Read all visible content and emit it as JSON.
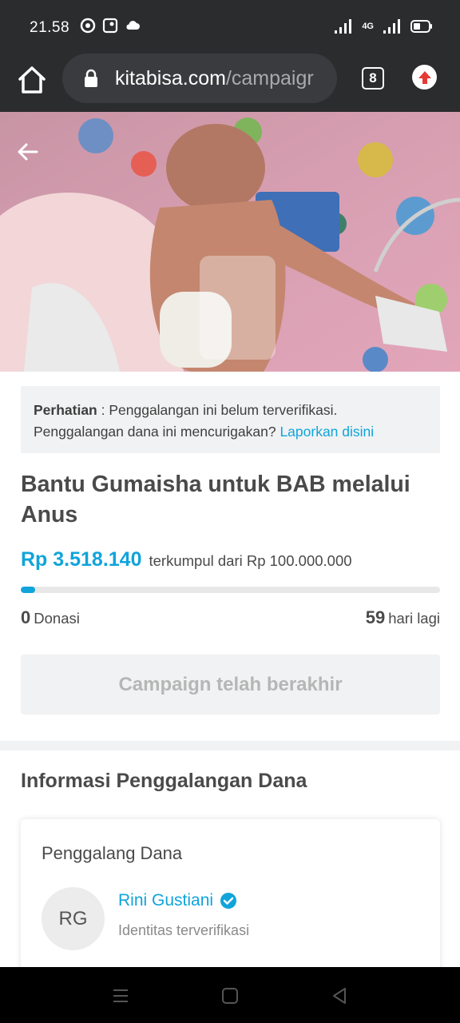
{
  "status_bar": {
    "time": "21.58",
    "network": "4G"
  },
  "browser": {
    "url_domain": "kitabisa.com",
    "url_path": "/campaigr",
    "tab_count": "8"
  },
  "warning": {
    "label": "Perhatian",
    "text": " : Penggalangan ini belum terverifikasi. Penggalangan dana ini mencurigakan? ",
    "link": "Laporkan disini"
  },
  "campaign": {
    "title": "Bantu Gumaisha untuk BAB melalui Anus",
    "amount": "Rp 3.518.140",
    "amount_suffix": "terkumpul dari Rp 100.000.000",
    "progress_fraction": 0.035,
    "donations_count": "0",
    "donations_label": "Donasi",
    "days_left": "59",
    "days_label": "hari lagi",
    "ended_button": "Campaign telah berakhir"
  },
  "fundraising_info": {
    "section_title": "Informasi Penggalangan Dana",
    "card_title": "Penggalang Dana",
    "avatar_initials": "RG",
    "organizer_name": "Rini Gustiani",
    "organizer_status": "Identitas terverifikasi"
  },
  "colors": {
    "accent": "#10a4db",
    "chrome_bg": "#2b2c2e"
  },
  "icons": [
    "home-icon",
    "lock-icon",
    "tabs-icon",
    "update-icon",
    "back-arrow-icon",
    "verified-badge-icon",
    "menu-icon",
    "home-nav-icon",
    "back-nav-icon"
  ]
}
